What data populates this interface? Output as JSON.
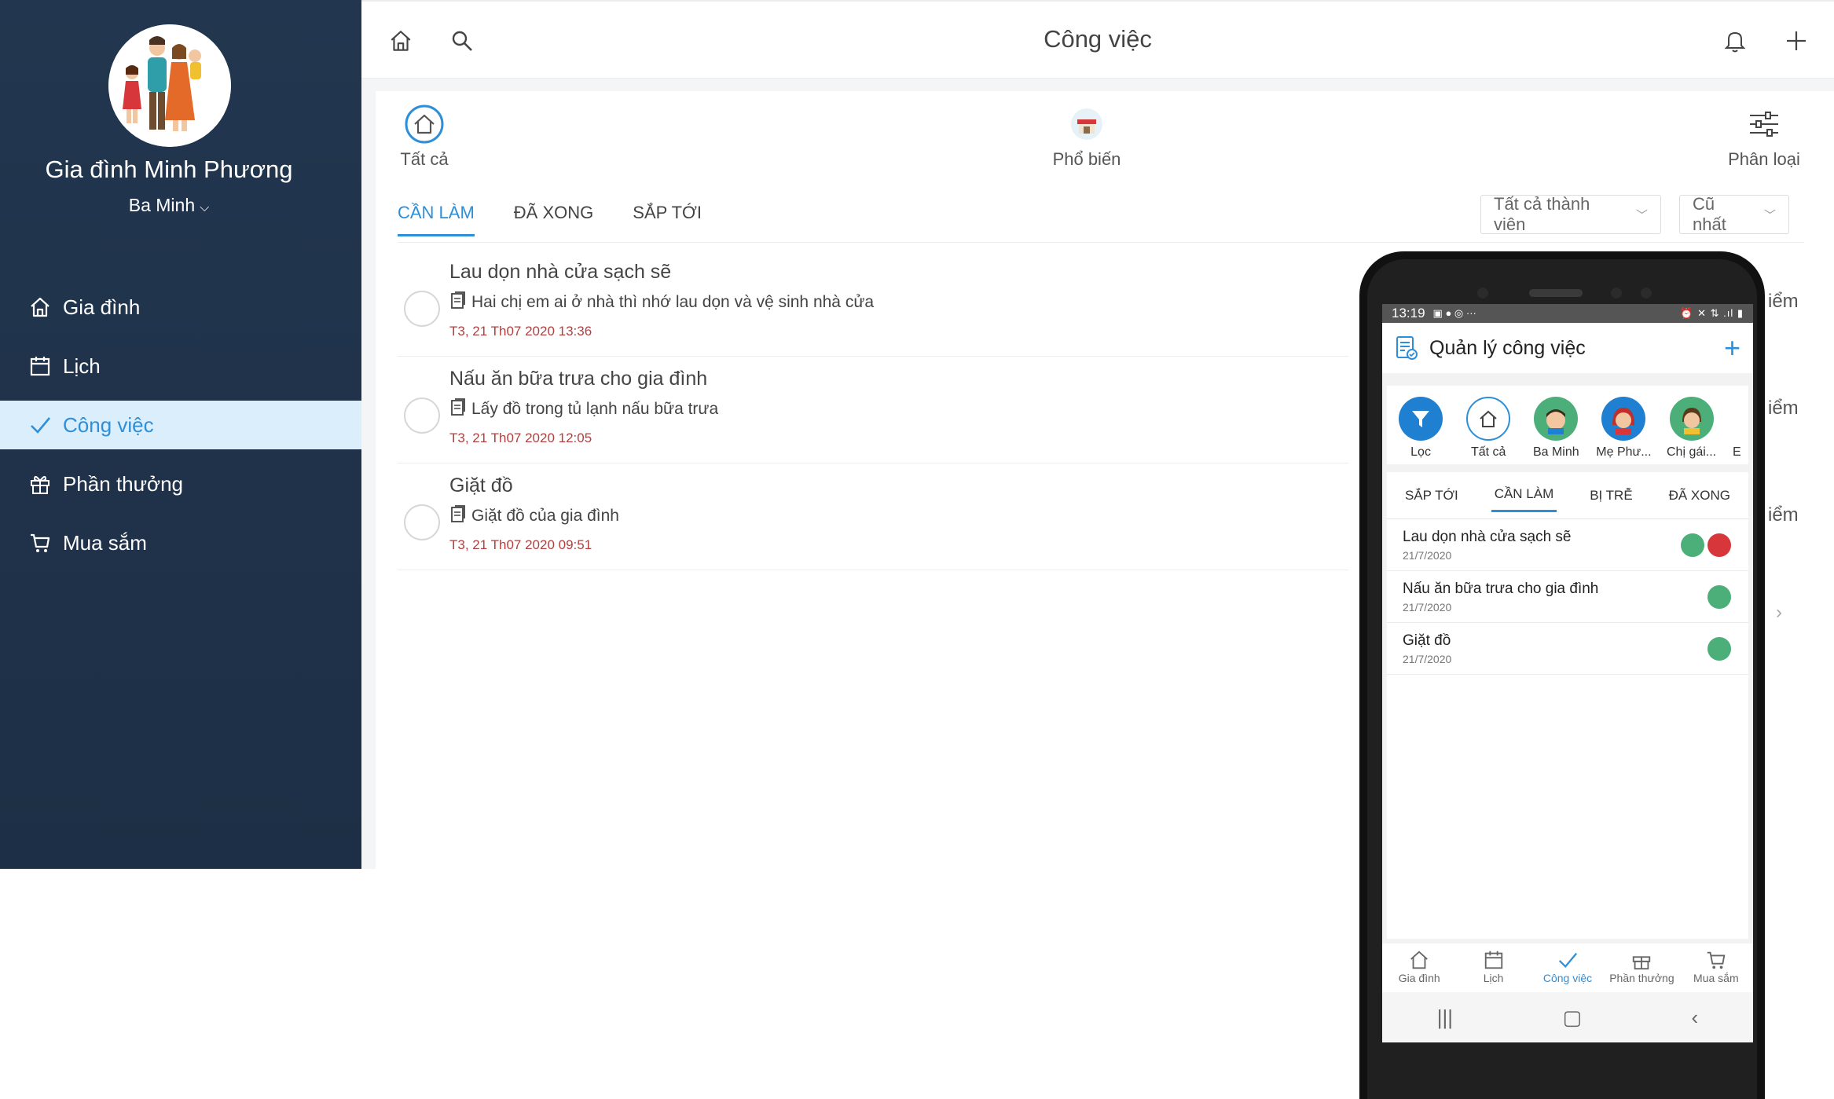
{
  "sidebar": {
    "family_name": "Gia đình Minh Phương",
    "user": "Ba Minh",
    "items": [
      {
        "label": "Gia đình",
        "icon": "home-icon"
      },
      {
        "label": "Lịch",
        "icon": "calendar-icon"
      },
      {
        "label": "Công việc",
        "icon": "check-icon",
        "active": true
      },
      {
        "label": "Phần thưởng",
        "icon": "gift-icon"
      },
      {
        "label": "Mua sắm",
        "icon": "cart-icon"
      }
    ]
  },
  "topbar": {
    "title": "Công việc"
  },
  "filters": {
    "all": "Tất cả",
    "popular": "Phổ biến",
    "classify": "Phân loại"
  },
  "tabs": {
    "todo": "CẦN LÀM",
    "done": "ĐÃ XONG",
    "upcoming": "SẮP TỚI"
  },
  "selects": {
    "members": "Tất cả thành viên",
    "sort": "Cũ nhất"
  },
  "tasks": [
    {
      "title": "Lau dọn nhà cửa sạch sẽ",
      "desc": "Hai chị em ai ở nhà thì nhớ lau dọn và vệ sinh nhà cửa",
      "time": "T3, 21 Th07 2020 13:36"
    },
    {
      "title": "Nấu ăn bữa trưa cho gia đình",
      "desc": "Lấy đồ trong tủ lạnh nấu bữa trưa",
      "time": "T3, 21 Th07 2020 12:05"
    },
    {
      "title": "Giặt đồ",
      "desc": "Giặt đồ của gia đình",
      "time": "T3, 21 Th07 2020 09:51"
    }
  ],
  "side_partial": "iểm",
  "phone": {
    "time": "13:19",
    "header": "Quản lý công việc",
    "members": [
      "Lọc",
      "Tất cả",
      "Ba Minh",
      "Mẹ Phư...",
      "Chị gái...",
      "E"
    ],
    "tabs": [
      "SẮP TỚI",
      "CẦN LÀM",
      "BỊ TRỄ",
      "ĐÃ XONG"
    ],
    "items": [
      {
        "title": "Lau dọn nhà cửa sạch sẽ",
        "date": "21/7/2020"
      },
      {
        "title": "Nấu ăn bữa trưa cho gia đình",
        "date": "21/7/2020"
      },
      {
        "title": "Giặt đồ",
        "date": "21/7/2020"
      }
    ],
    "bottom_nav": [
      "Gia đình",
      "Lịch",
      "Công việc",
      "Phần thưởng",
      "Mua sắm"
    ]
  },
  "colors": {
    "sidebar": "#22364f",
    "accent": "#2d8fd8",
    "active_bg": "#dbeefb",
    "time": "#b04040"
  }
}
